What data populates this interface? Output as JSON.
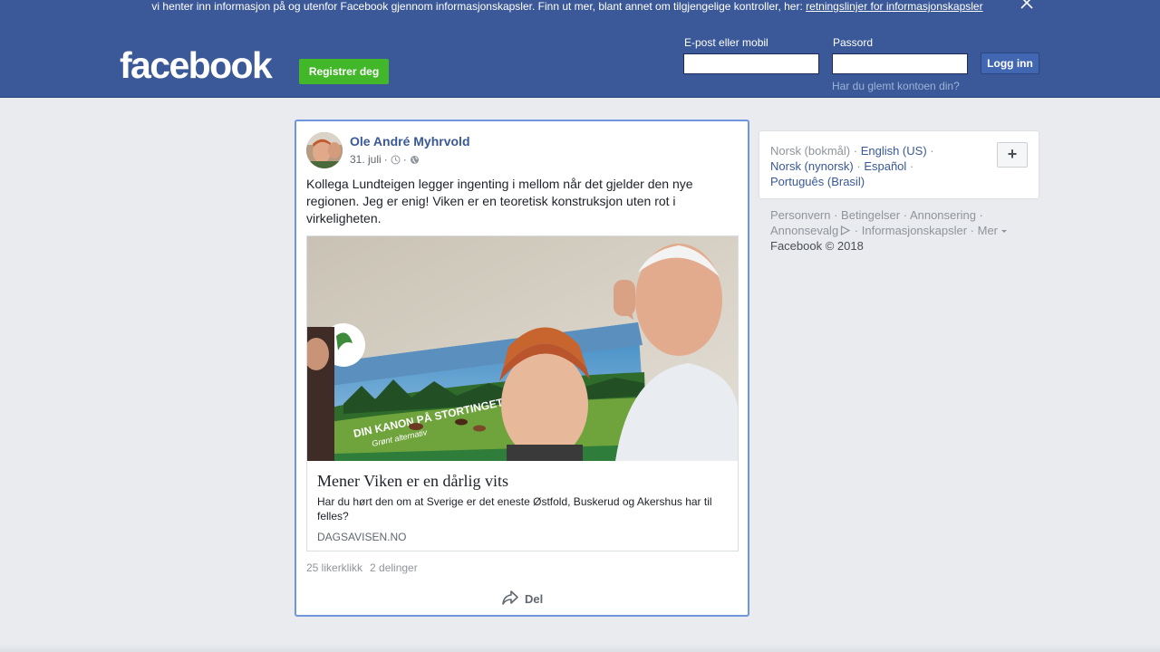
{
  "cookie_banner": {
    "text": "vi henter inn informasjon på og utenfor Facebook gjennom informasjonskapsler. Finn ut mer, blant annet om tilgjengelige kontroller, her: ",
    "link": "retningslinjer for informasjonskapsler"
  },
  "header": {
    "logo": "facebook",
    "register_label": "Registrer deg",
    "email_label": "E-post eller mobil",
    "password_label": "Passord",
    "login_label": "Logg inn",
    "forgot_label": "Har du glemt kontoen din?"
  },
  "post": {
    "author": "Ole André Myhrvold",
    "date": "31. juli",
    "text": "Kollega Lundteigen legger ingenting i mellom når det gjelder den nye regionen. Jeg er enig! Viken er en teoretisk konstruksjon uten rot i virkeligheten.",
    "link": {
      "title": "Mener Viken er en dårlig vits",
      "description": "Har du hørt den om at Sverige er det eneste Østfold, Buskerud og Akershus har til felles?",
      "domain": "DAGSAVISEN.NO",
      "image_text_1": "DIN KANON PÅ STORTINGET",
      "image_text_2": "Grønt alternativ"
    },
    "likes": "25 likerklikk",
    "shares": "2 delinger",
    "share_label": "Del"
  },
  "languages": {
    "current": "Norsk (bokmål)",
    "items": [
      "English (US)",
      "Norsk (nynorsk)",
      "Español",
      "Português (Brasil)"
    ],
    "more_label": "+"
  },
  "footer": {
    "links": [
      "Personvern",
      "Betingelser",
      "Annonsering",
      "Annonsevalg",
      "Informasjonskapsler",
      "Mer"
    ],
    "copyright": "Facebook © 2018"
  },
  "colors": {
    "brand_blue": "#3b5998",
    "link_blue": "#385898",
    "register_green": "#42b72a"
  }
}
